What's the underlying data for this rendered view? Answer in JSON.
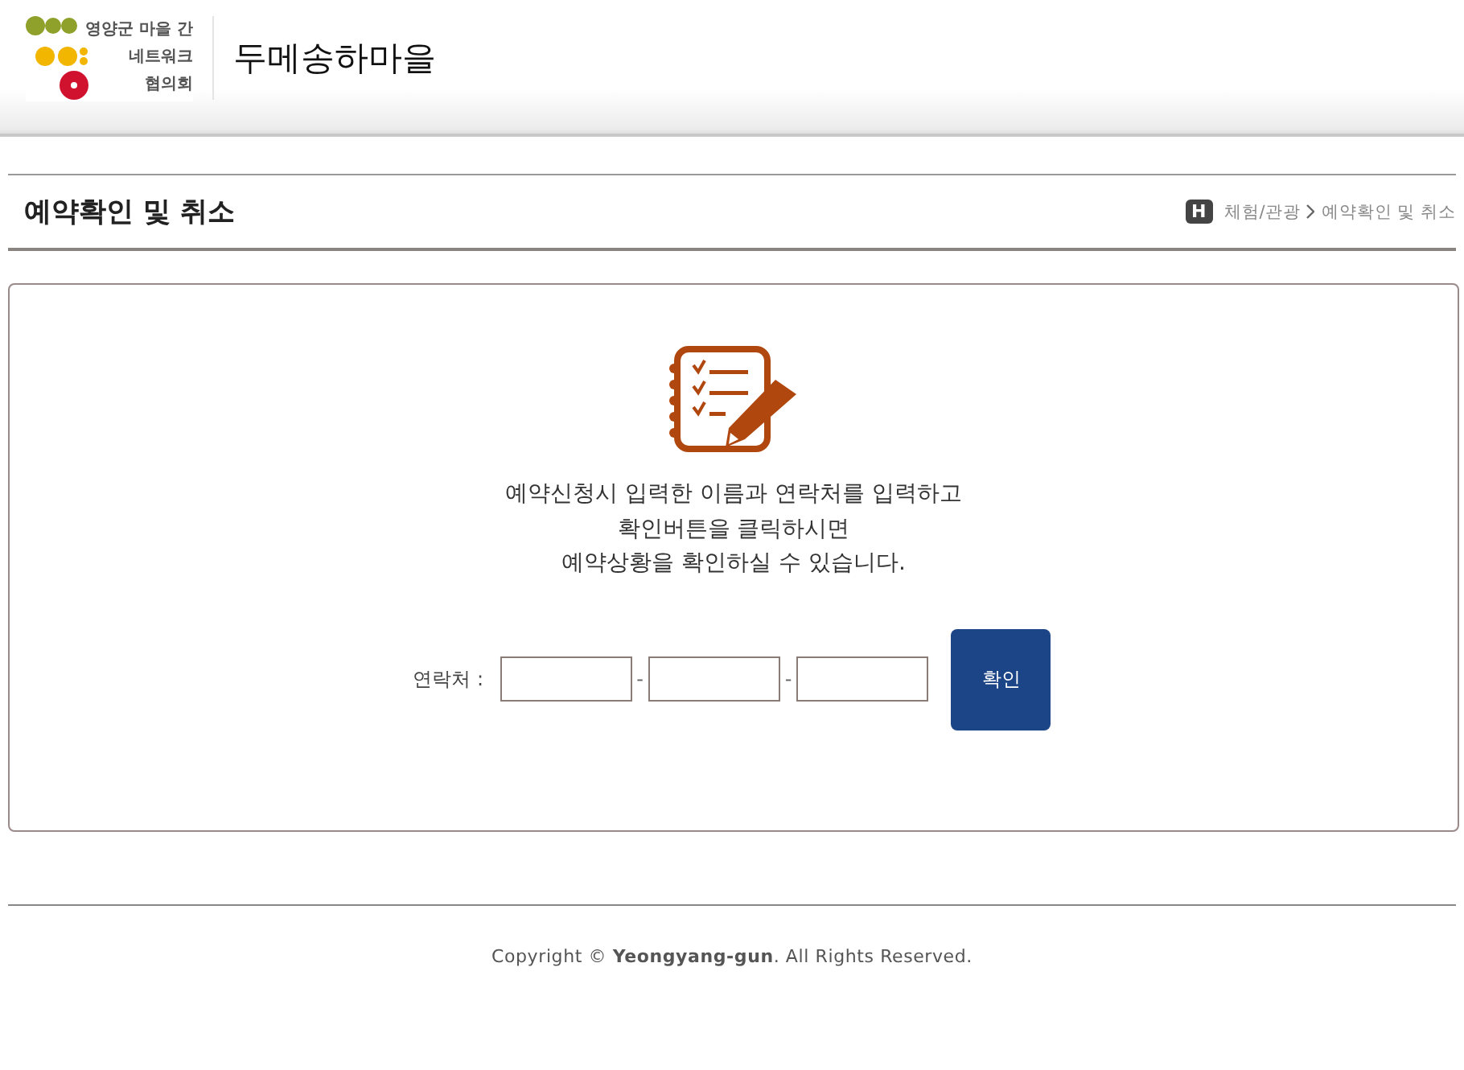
{
  "header": {
    "logo_lines": [
      "영양군 마을 간",
      "네트워크",
      "협의회"
    ],
    "site_name": "두메송하마을"
  },
  "page": {
    "title": "예약확인 및 취소",
    "breadcrumb": {
      "home": "H",
      "items": [
        "체험/관광",
        "예약확인 및 취소"
      ]
    }
  },
  "lookup": {
    "message_lines": [
      "예약신청시 입력한 이름과 연락처를 입력하고",
      "확인버튼을 클릭하시면",
      "예약상황을 확인하실 수 있습니다."
    ],
    "field_label": "연락처 :",
    "separators": [
      "-",
      "-"
    ],
    "button": "확인"
  },
  "footer": {
    "copyright": "Copyright © **Yeongyang-gun**. All Rights Reserved."
  }
}
